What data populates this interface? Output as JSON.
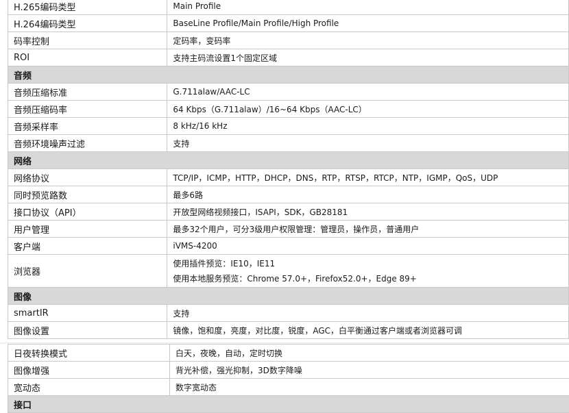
{
  "table_main": [
    {
      "type": "row",
      "key": "H.265编码类型",
      "value": "Main Profile"
    },
    {
      "type": "row",
      "key": "H.264编码类型",
      "value": "BaseLine Profile/Main Profile/High Profile"
    },
    {
      "type": "row",
      "key": "码率控制",
      "value": "定码率，变码率"
    },
    {
      "type": "row",
      "key": "ROI",
      "value": "支持主码流设置1个固定区域"
    },
    {
      "type": "section",
      "key": "音频"
    },
    {
      "type": "row",
      "key": "音频压缩标准",
      "value": "G.711alaw/AAC-LC"
    },
    {
      "type": "row",
      "key": "音频压缩码率",
      "value": "64 Kbps（G.711alaw）/16~64 Kbps（AAC-LC）"
    },
    {
      "type": "row",
      "key": "音频采样率",
      "value": "8 kHz/16 kHz"
    },
    {
      "type": "row",
      "key": "音频环境噪声过滤",
      "value": "支持"
    },
    {
      "type": "section",
      "key": "网络"
    },
    {
      "type": "row",
      "key": "网络协议",
      "value": "TCP/IP，ICMP，HTTP，DHCP，DNS，RTP，RTSP，RTCP，NTP，IGMP，QoS，UDP"
    },
    {
      "type": "row",
      "key": "同时预览路数",
      "value": "最多6路"
    },
    {
      "type": "row",
      "key": "接口协议（API）",
      "value": "开放型网络视频接口，ISAPI，SDK，GB28181"
    },
    {
      "type": "row",
      "key": "用户管理",
      "value": "最多32个用户，可分3级用户权限管理：管理员，操作员，普通用户"
    },
    {
      "type": "row",
      "key": "客户端",
      "value": "iVMS-4200"
    },
    {
      "type": "multi",
      "key": "浏览器",
      "lines": [
        "使用插件预览：IE10，IE11",
        "使用本地服务预览：Chrome 57.0+，Firefox52.0+，Edge 89+"
      ]
    },
    {
      "type": "section",
      "key": "图像"
    },
    {
      "type": "row",
      "key": "smartIR",
      "value": "支持"
    },
    {
      "type": "row",
      "key": "图像设置",
      "value": "镜像，饱和度，亮度，对比度，锐度，AGC，白平衡通过客户端或者浏览器可调"
    }
  ],
  "table_lower": [
    {
      "type": "row",
      "key": "日夜转换模式",
      "value": "白天，夜晚，自动，定时切换"
    },
    {
      "type": "row",
      "key": "图像增强",
      "value": "背光补偿，强光抑制，3D数字降噪"
    },
    {
      "type": "row",
      "key": "宽动态",
      "value": "数字宽动态"
    },
    {
      "type": "section",
      "key": "接口"
    }
  ]
}
